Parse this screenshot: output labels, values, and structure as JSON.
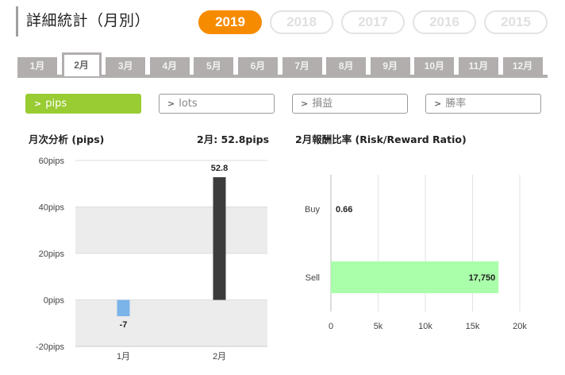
{
  "page": {
    "title": "詳細統計（月別）"
  },
  "years": [
    {
      "label": "2019",
      "active": true
    },
    {
      "label": "2018",
      "active": false
    },
    {
      "label": "2017",
      "active": false
    },
    {
      "label": "2016",
      "active": false
    },
    {
      "label": "2015",
      "active": false
    }
  ],
  "months": [
    {
      "label": "1月",
      "active": false
    },
    {
      "label": "2月",
      "active": true
    },
    {
      "label": "3月",
      "active": false
    },
    {
      "label": "4月",
      "active": false
    },
    {
      "label": "5月",
      "active": false
    },
    {
      "label": "6月",
      "active": false
    },
    {
      "label": "7月",
      "active": false
    },
    {
      "label": "8月",
      "active": false
    },
    {
      "label": "9月",
      "active": false
    },
    {
      "label": "10月",
      "active": false
    },
    {
      "label": "11月",
      "active": false
    },
    {
      "label": "12月",
      "active": false
    }
  ],
  "metrics": [
    {
      "label": "pips",
      "active": true
    },
    {
      "label": "lots",
      "active": false
    },
    {
      "label": "損益",
      "active": false
    },
    {
      "label": "勝率",
      "active": false
    }
  ],
  "colors": {
    "accent_orange": "#f78b00",
    "active_green": "#99cc33",
    "bar_negative": "#7ab4e8",
    "bar_positive": "#3c3c3c",
    "bar_sell": "#aaffaa"
  },
  "monthly_chart": {
    "heading_left": "月次分析 (pips)",
    "heading_right": "2月: 52.8pips"
  },
  "ratio_chart": {
    "heading": "2月報酬比率 (Risk/Reward Ratio)"
  },
  "chart_data": [
    {
      "type": "bar",
      "categories": [
        "1月",
        "2月"
      ],
      "values": [
        -7,
        52.8
      ],
      "data_labels": [
        "-7",
        "52.8"
      ],
      "ylim": [
        -20,
        60
      ],
      "yticks": [
        60,
        40,
        20,
        0,
        -20
      ],
      "ytick_labels": [
        "60pips",
        "40pips",
        "20pips",
        "0pips",
        "-20pips"
      ],
      "grid": "alternating bands"
    },
    {
      "type": "bar",
      "orientation": "horizontal",
      "categories": [
        "Buy",
        "Sell"
      ],
      "values": [
        0.66,
        17750
      ],
      "data_labels": [
        "0.66",
        "17,750"
      ],
      "xlim": [
        0,
        20000
      ],
      "xticks": [
        0,
        5000,
        10000,
        15000,
        20000
      ],
      "xtick_labels": [
        "0",
        "5k",
        "10k",
        "15k",
        "20k"
      ],
      "grid": "vertical lines"
    }
  ]
}
